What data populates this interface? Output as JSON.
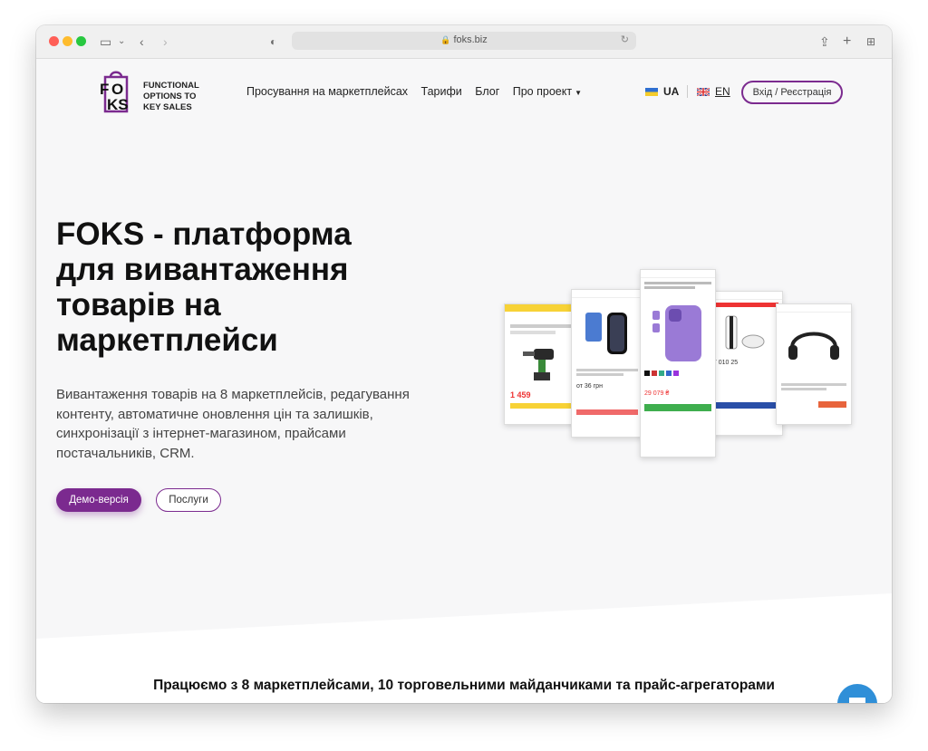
{
  "browser": {
    "url": "foks.biz",
    "icons": {
      "sidebar": "sidebar-icon",
      "back": "chevron-left-icon",
      "forward": "chevron-right-icon",
      "privacy": "shield-icon",
      "share": "share-icon",
      "new_tab": "plus-icon",
      "tabs": "grid-icon",
      "reload": "reload-icon"
    }
  },
  "header": {
    "logo_text": "FUNCTIONAL\nOPTIONS TO\nKEY SALES",
    "logo_mark": "FOKS",
    "nav": [
      "Просування на маркетплейсах",
      "Тарифи",
      "Блог",
      "Про проект"
    ],
    "lang_ua": "UA",
    "lang_en": "EN",
    "login": "Вхід / Реєстрація"
  },
  "hero": {
    "title_lines": [
      "FOKS - платформа",
      "для вивантаження",
      "товарів на",
      "маркетплейси"
    ],
    "description": "Вивантаження товарів на 8 маркетплейсів, редагування контенту, автоматичне оновлення цін та залишків, синхронізації з інтернет-магазином, прайсами постачальників, CRM.",
    "demo_button": "Демо-версія",
    "services_button": "Послуги"
  },
  "cards": {
    "card1_price": "1 459",
    "card2_price": "от 36 грн",
    "card3_price": "29 079 ₴",
    "card4_price": "17 010 25"
  },
  "bottom": {
    "title": "Працюємо з 8 маркетплейсами, 10 торговельними майданчиками та прайс-агрегаторами"
  },
  "colors": {
    "accent": "#7b2a8f",
    "chat": "#2f8fd8",
    "background": "#f7f7f8"
  }
}
